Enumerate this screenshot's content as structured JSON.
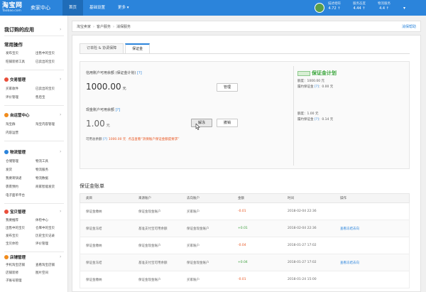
{
  "header": {
    "logo_cn": "淘宝网",
    "logo_en": "Taobao.com",
    "title": "卖家中心",
    "nav": [
      "首页",
      "基础设置",
      "更多 ▾"
    ],
    "stats": [
      {
        "label": "描述相符",
        "value": "4.72 ↑"
      },
      {
        "label": "服务态度",
        "value": "4.44 ↑"
      },
      {
        "label": "物流服务",
        "value": "4.4 ↑"
      }
    ],
    "caret": "▾"
  },
  "sidebar": {
    "title": "我订购的应用",
    "arrow": "›",
    "common_label": "常用操作",
    "common_links": [
      "发布宝贝",
      "出售中的宝贝",
      "旺铺装修工具",
      "已卖出的宝贝"
    ],
    "sections": [
      {
        "title": "交易管理",
        "links": [
          "买家收件",
          "已卖出的宝贝",
          "评价管理",
          "售后宝"
        ]
      },
      {
        "title": "自运营中心",
        "links": [
          "淘宝群",
          "淘宝内容管理",
          "内容运营"
        ]
      },
      {
        "title": "物流管理",
        "links": [
          "仓储管理",
          "物流工具",
          "发货",
          "物流服务",
          "我要寄快递",
          "物流数据",
          "裹裹预约",
          "商家智能发货",
          "电子面单平台"
        ]
      },
      {
        "title": "宝贝管理",
        "links": [
          "我要推荐",
          "体检中心",
          "出售中的宝贝",
          "仓库中的宝贝",
          "发布宝贝",
          "历史宝贝记录",
          "宝贝体检",
          "评价管理"
        ]
      },
      {
        "title": "店铺管理",
        "links": [
          "手机淘宝店铺",
          "查看淘宝店铺",
          "店铺装修",
          "图片空间",
          "子账号管理"
        ]
      }
    ]
  },
  "breadcrumb": [
    "淘宝卖家",
    "客户服务",
    "消保服务"
  ],
  "help": "消保帮助",
  "tabs": [
    "订单险 & 协调保障",
    "保证金"
  ],
  "balance": {
    "credit_label": "信用账户可用余额 (保证金计划)",
    "q": "[?]",
    "credit_amount": "1000.00",
    "unit": "元",
    "manage_btn": "管理",
    "cash_label": "现金账户可用余额",
    "cash_amount": "1.00",
    "unfreeze_btn": "解冻",
    "withdraw_btn": "撤销",
    "avail_label": "可用总余额",
    "avail_amount": "1000.00 元",
    "avail_link": "点击查看“消保账户保证金额度要求”"
  },
  "right_info": {
    "brand": "保证金计划",
    "line1": "额度：1000.00 元",
    "line2_a": "履约保证金",
    "line2_b": "：0.00 元",
    "line3": "额度：1.00 元",
    "line4_a": "履约保证金",
    "line4_b": "：0.14 元"
  },
  "ledger": {
    "title": "保证金账单",
    "columns": [
      "类目",
      "来源账户",
      "去向账户",
      "金额",
      "时间",
      "操作"
    ],
    "rows": [
      [
        "保证金缴纳",
        "保证金现金账户",
        "买家账户",
        "-0.01",
        "2018-02-04 22:36",
        ""
      ],
      [
        "保证金冻结",
        "基准支付宝可用余额",
        "保证金现金账户",
        "+0.01",
        "2018-02-04 22:36",
        "查看冻结去向"
      ],
      [
        "保证金缴纳",
        "保证金现金账户",
        "买家账户",
        "-0.04",
        "2018-01-27 17:02",
        ""
      ],
      [
        "保证金冻结",
        "基准支付宝可用余额",
        "保证金现金账户",
        "+0.04",
        "2018-01-27 17:02",
        "查看冻结去向"
      ],
      [
        "保证金缴纳",
        "保证金现金账户",
        "买家账户",
        "-0.01",
        "2018-01-24 15:00",
        ""
      ]
    ]
  }
}
